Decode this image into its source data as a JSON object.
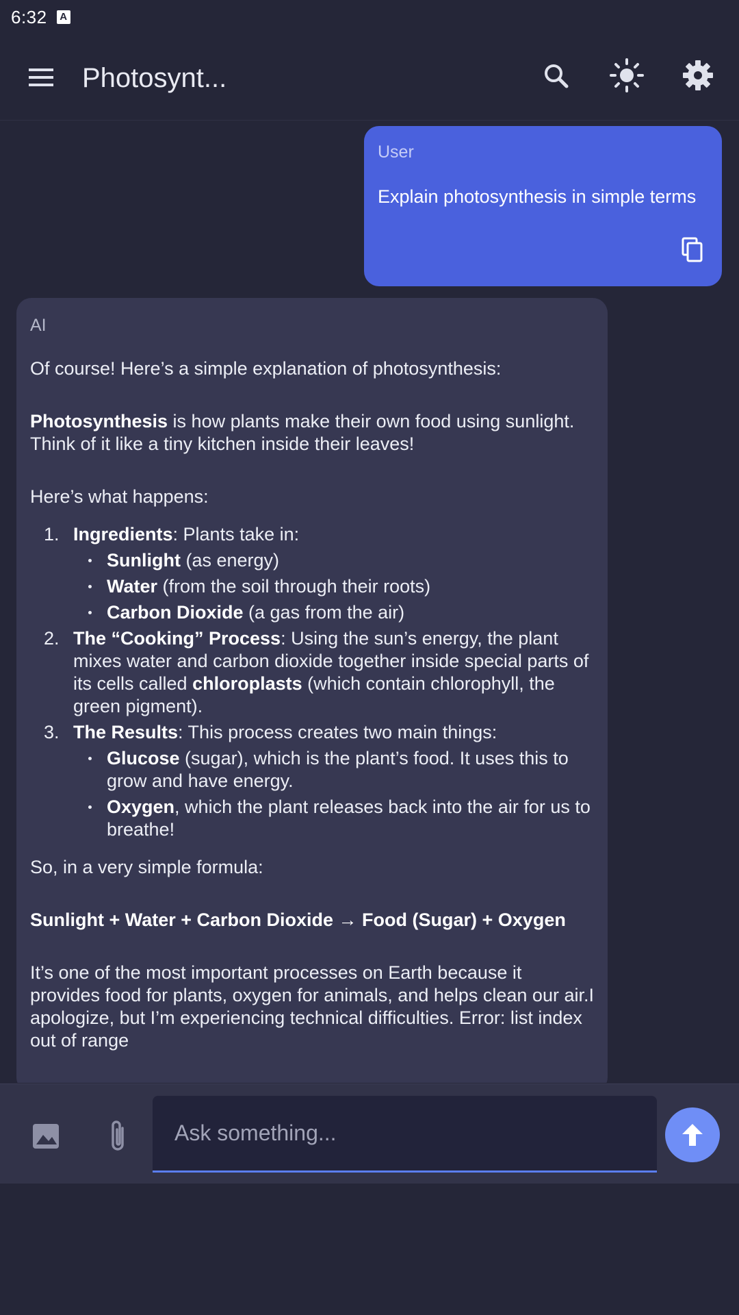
{
  "status_bar": {
    "time": "6:32",
    "notification_icon": "a-icon"
  },
  "app_bar": {
    "title": "Photosynt...",
    "icons": {
      "menu": "hamburger-menu-icon",
      "search": "search-icon",
      "theme": "brightness-icon",
      "settings": "gear-icon"
    }
  },
  "user_message": {
    "sender": "User",
    "text": "Explain photosynthesis in simple terms",
    "copy_icon": "copy-icon"
  },
  "ai_message": {
    "sender": "AI",
    "intro": "Of course! Here’s a simple explanation of photosynthesis:",
    "def_bold": "Photosynthesis",
    "def_rest": " is how plants make their own food using sunlight. Think of it like a tiny kitchen inside their leaves!",
    "happens": "Here’s what happens:",
    "steps": [
      {
        "num": "1.",
        "bold": "Ingredients",
        "rest": ": Plants take in:",
        "bullets": [
          {
            "bold": "Sunlight",
            "rest": " (as energy)"
          },
          {
            "bold": "Water",
            "rest": " (from the soil through their roots)"
          },
          {
            "bold": "Carbon Dioxide",
            "rest": " (a gas from the air)"
          }
        ]
      },
      {
        "num": "2.",
        "bold": "The “Cooking” Process",
        "rest": ": Using the sun’s energy, the plant mixes water and carbon dioxide together inside special parts of its cells called ",
        "bold2": "chloroplasts",
        "rest2": " (which contain chlorophyll, the green pigment)."
      },
      {
        "num": "3.",
        "bold": "The Results",
        "rest": ": This process creates two main things:",
        "bullets": [
          {
            "bold": "Glucose",
            "rest": " (sugar), which is the plant’s food. It uses this to grow and have energy."
          },
          {
            "bold": "Oxygen",
            "rest": ", which the plant releases back into the air for us to breathe!"
          }
        ]
      }
    ],
    "formula_intro": "So, in a very simple formula:",
    "formula": "Sunlight + Water + Carbon Dioxide → Food (Sugar) + Oxygen",
    "closing": "It’s one of the most important processes on Earth because it provides food for plants, oxygen for animals, and helps clean our air.I apologize, but I’m experiencing technical difficulties. Error: list index out of range"
  },
  "input_bar": {
    "placeholder": "Ask something...",
    "value": "",
    "icons": {
      "image": "image-icon",
      "attach": "paperclip-icon",
      "send": "arrow-up-icon"
    }
  },
  "colors": {
    "background": "#252638",
    "ai_bubble": "#373852",
    "user_bubble": "#4a61dd",
    "input_bar": "#323349",
    "accent": "#6f8ef6"
  }
}
